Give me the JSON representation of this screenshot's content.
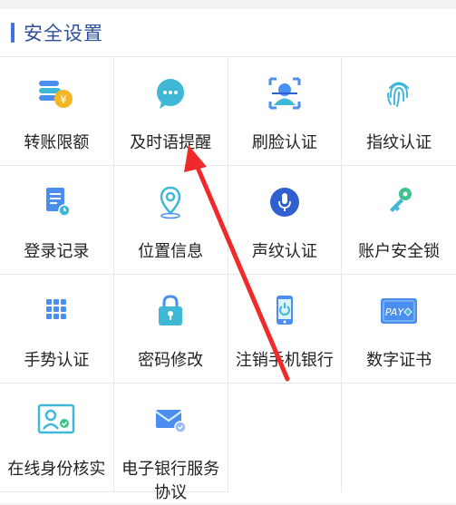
{
  "section": {
    "title": "安全设置"
  },
  "colors": {
    "accent": "#3f6fe0",
    "icon_blue": "#4a8ff0",
    "icon_cyan": "#3fb8d8",
    "coin": "#f5b623",
    "arrow": "#f02a2a"
  },
  "items": [
    {
      "label": "转账限额",
      "icon": "coin-stack-icon"
    },
    {
      "label": "及时语提醒",
      "icon": "chat-bubble-icon"
    },
    {
      "label": "刷脸认证",
      "icon": "face-scan-icon"
    },
    {
      "label": "指纹认证",
      "icon": "fingerprint-icon"
    },
    {
      "label": "登录记录",
      "icon": "document-icon"
    },
    {
      "label": "位置信息",
      "icon": "location-pin-icon"
    },
    {
      "label": "声纹认证",
      "icon": "microphone-icon"
    },
    {
      "label": "账户安全锁",
      "icon": "key-icon"
    },
    {
      "label": "手势认证",
      "icon": "keypad-grid-icon"
    },
    {
      "label": "密码修改",
      "icon": "padlock-icon"
    },
    {
      "label": "注销手机银行",
      "icon": "phone-power-icon"
    },
    {
      "label": "数字证书",
      "icon": "pay-card-icon"
    },
    {
      "label": "在线身份核实",
      "icon": "id-verify-icon"
    },
    {
      "label": "电子银行服务协议",
      "icon": "mail-agreement-icon"
    }
  ]
}
